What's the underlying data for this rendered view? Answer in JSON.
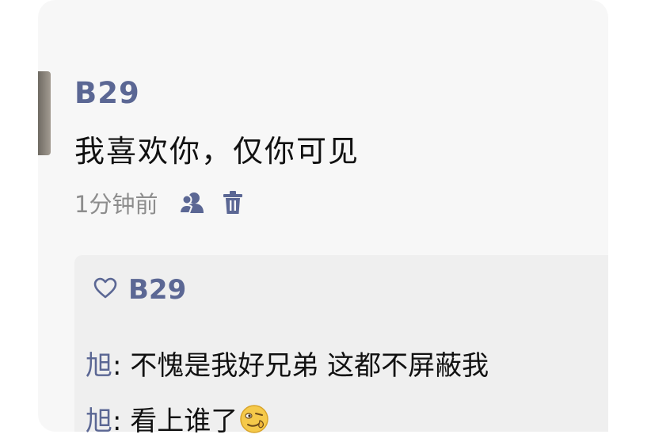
{
  "post": {
    "username": "B29",
    "message": "我喜欢你，仅你可见",
    "timestamp": "1分钟前",
    "icons": {
      "visibility": "friends-icon",
      "delete": "trash-icon"
    }
  },
  "likes": {
    "names": "B29",
    "icon": "heart-outline-icon"
  },
  "comments": [
    {
      "author": "旭",
      "separator": ": ",
      "text": "不愧是我好兄弟 这都不屏蔽我"
    },
    {
      "author": "旭",
      "separator": ": ",
      "text": "看上谁了",
      "emoji": "smirk-emoji"
    }
  ],
  "colors": {
    "name": "#5b6794",
    "text": "#111111",
    "meta": "#8d8d8d",
    "card": "#f7f7f7",
    "comment_bg": "#efefef"
  }
}
